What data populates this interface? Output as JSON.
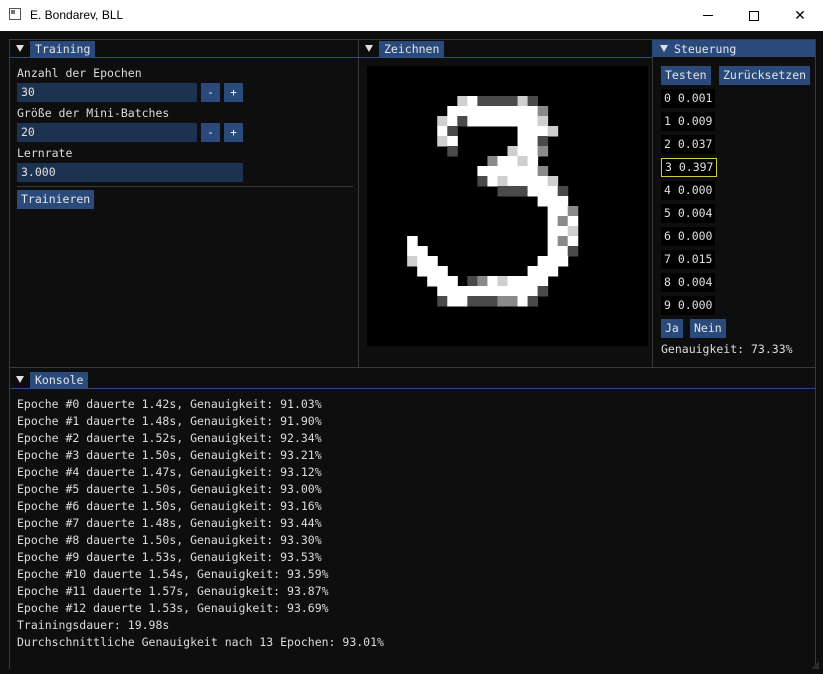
{
  "window": {
    "title": "E. Bondarev, BLL"
  },
  "training": {
    "tab": "Training",
    "epochs_label": "Anzahl der Epochen",
    "epochs_value": "30",
    "batch_label": "Größe der Mini-Batches",
    "batch_value": "20",
    "lr_label": "Lernrate",
    "lr_value": "3.000",
    "minus": "-",
    "plus": "+",
    "train_button": "Trainieren"
  },
  "drawing": {
    "tab": "Zeichnen"
  },
  "control": {
    "tab": "Steuerung",
    "test_button": "Testen",
    "reset_button": "Zurücksetzen",
    "outputs": [
      "0 0.001",
      "1 0.009",
      "2 0.037",
      "3 0.397",
      "4 0.000",
      "5 0.004",
      "6 0.000",
      "7 0.015",
      "8 0.004",
      "9 0.000"
    ],
    "highlighted_index": 3,
    "yes_button": "Ja",
    "no_button": "Nein",
    "accuracy": "Genauigkeit: 73.33%"
  },
  "console": {
    "tab": "Konsole",
    "lines": [
      "Epoche #0 dauerte 1.42s, Genauigkeit: 91.03%",
      "Epoche #1 dauerte 1.48s, Genauigkeit: 91.90%",
      "Epoche #2 dauerte 1.52s, Genauigkeit: 92.34%",
      "Epoche #3 dauerte 1.50s, Genauigkeit: 93.21%",
      "Epoche #4 dauerte 1.47s, Genauigkeit: 93.12%",
      "Epoche #5 dauerte 1.50s, Genauigkeit: 93.00%",
      "Epoche #6 dauerte 1.50s, Genauigkeit: 93.16%",
      "Epoche #7 dauerte 1.48s, Genauigkeit: 93.44%",
      "Epoche #8 dauerte 1.50s, Genauigkeit: 93.30%",
      "Epoche #9 dauerte 1.53s, Genauigkeit: 93.53%",
      "Epoche #10 dauerte 1.54s, Genauigkeit: 93.59%",
      "Epoche #11 dauerte 1.57s, Genauigkeit: 93.87%",
      "Epoche #12 dauerte 1.53s, Genauigkeit: 93.69%",
      "Trainingsdauer: 19.98s",
      "Durchschnittliche Genauigkeit nach 13 Epochen: 93.01%"
    ]
  },
  "colors": {
    "background": "#0e0e0e",
    "accent": "#294a7a",
    "input": "#1d3250",
    "highlight_border": "#d6cc4a"
  }
}
